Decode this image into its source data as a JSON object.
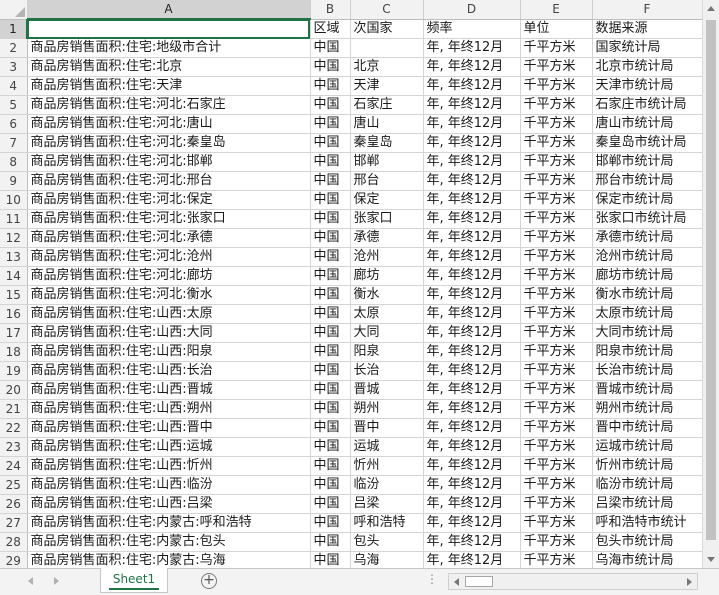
{
  "sheet": {
    "column_headers": [
      "A",
      "B",
      "C",
      "D",
      "E",
      "F"
    ],
    "rows": [
      {
        "n": "1",
        "a": "",
        "b": "区域",
        "c": "次国家",
        "d": "频率",
        "e": "单位",
        "f": "数据来源"
      },
      {
        "n": "2",
        "a": "商品房销售面积:住宅:地级市合计",
        "b": "中国",
        "c": "",
        "d": "年, 年终12月",
        "e": "千平方米",
        "f": "国家统计局"
      },
      {
        "n": "3",
        "a": "商品房销售面积:住宅:北京",
        "b": "中国",
        "c": "北京",
        "d": "年, 年终12月",
        "e": "千平方米",
        "f": "北京市统计局"
      },
      {
        "n": "4",
        "a": "商品房销售面积:住宅:天津",
        "b": "中国",
        "c": "天津",
        "d": "年, 年终12月",
        "e": "千平方米",
        "f": "天津市统计局"
      },
      {
        "n": "5",
        "a": "商品房销售面积:住宅:河北:石家庄",
        "b": "中国",
        "c": "石家庄",
        "d": "年, 年终12月",
        "e": "千平方米",
        "f": "石家庄市统计局"
      },
      {
        "n": "6",
        "a": "商品房销售面积:住宅:河北:唐山",
        "b": "中国",
        "c": "唐山",
        "d": "年, 年终12月",
        "e": "千平方米",
        "f": "唐山市统计局"
      },
      {
        "n": "7",
        "a": "商品房销售面积:住宅:河北:秦皇岛",
        "b": "中国",
        "c": "秦皇岛",
        "d": "年, 年终12月",
        "e": "千平方米",
        "f": "秦皇岛市统计局"
      },
      {
        "n": "8",
        "a": "商品房销售面积:住宅:河北:邯郸",
        "b": "中国",
        "c": "邯郸",
        "d": "年, 年终12月",
        "e": "千平方米",
        "f": "邯郸市统计局"
      },
      {
        "n": "9",
        "a": "商品房销售面积:住宅:河北:邢台",
        "b": "中国",
        "c": "邢台",
        "d": "年, 年终12月",
        "e": "千平方米",
        "f": "邢台市统计局"
      },
      {
        "n": "10",
        "a": "商品房销售面积:住宅:河北:保定",
        "b": "中国",
        "c": "保定",
        "d": "年, 年终12月",
        "e": "千平方米",
        "f": "保定市统计局"
      },
      {
        "n": "11",
        "a": "商品房销售面积:住宅:河北:张家口",
        "b": "中国",
        "c": "张家口",
        "d": "年, 年终12月",
        "e": "千平方米",
        "f": "张家口市统计局"
      },
      {
        "n": "12",
        "a": "商品房销售面积:住宅:河北:承德",
        "b": "中国",
        "c": "承德",
        "d": "年, 年终12月",
        "e": "千平方米",
        "f": "承德市统计局"
      },
      {
        "n": "13",
        "a": "商品房销售面积:住宅:河北:沧州",
        "b": "中国",
        "c": "沧州",
        "d": "年, 年终12月",
        "e": "千平方米",
        "f": "沧州市统计局"
      },
      {
        "n": "14",
        "a": "商品房销售面积:住宅:河北:廊坊",
        "b": "中国",
        "c": "廊坊",
        "d": "年, 年终12月",
        "e": "千平方米",
        "f": "廊坊市统计局"
      },
      {
        "n": "15",
        "a": "商品房销售面积:住宅:河北:衡水",
        "b": "中国",
        "c": "衡水",
        "d": "年, 年终12月",
        "e": "千平方米",
        "f": "衡水市统计局"
      },
      {
        "n": "16",
        "a": "商品房销售面积:住宅:山西:太原",
        "b": "中国",
        "c": "太原",
        "d": "年, 年终12月",
        "e": "千平方米",
        "f": "太原市统计局"
      },
      {
        "n": "17",
        "a": "商品房销售面积:住宅:山西:大同",
        "b": "中国",
        "c": "大同",
        "d": "年, 年终12月",
        "e": "千平方米",
        "f": "大同市统计局"
      },
      {
        "n": "18",
        "a": "商品房销售面积:住宅:山西:阳泉",
        "b": "中国",
        "c": "阳泉",
        "d": "年, 年终12月",
        "e": "千平方米",
        "f": "阳泉市统计局"
      },
      {
        "n": "19",
        "a": "商品房销售面积:住宅:山西:长治",
        "b": "中国",
        "c": "长治",
        "d": "年, 年终12月",
        "e": "千平方米",
        "f": "长治市统计局"
      },
      {
        "n": "20",
        "a": "商品房销售面积:住宅:山西:晋城",
        "b": "中国",
        "c": "晋城",
        "d": "年, 年终12月",
        "e": "千平方米",
        "f": "晋城市统计局"
      },
      {
        "n": "21",
        "a": "商品房销售面积:住宅:山西:朔州",
        "b": "中国",
        "c": "朔州",
        "d": "年, 年终12月",
        "e": "千平方米",
        "f": "朔州市统计局"
      },
      {
        "n": "22",
        "a": "商品房销售面积:住宅:山西:晋中",
        "b": "中国",
        "c": "晋中",
        "d": "年, 年终12月",
        "e": "千平方米",
        "f": "晋中市统计局"
      },
      {
        "n": "23",
        "a": "商品房销售面积:住宅:山西:运城",
        "b": "中国",
        "c": "运城",
        "d": "年, 年终12月",
        "e": "千平方米",
        "f": "运城市统计局"
      },
      {
        "n": "24",
        "a": "商品房销售面积:住宅:山西:忻州",
        "b": "中国",
        "c": "忻州",
        "d": "年, 年终12月",
        "e": "千平方米",
        "f": "忻州市统计局"
      },
      {
        "n": "25",
        "a": "商品房销售面积:住宅:山西:临汾",
        "b": "中国",
        "c": "临汾",
        "d": "年, 年终12月",
        "e": "千平方米",
        "f": "临汾市统计局"
      },
      {
        "n": "26",
        "a": "商品房销售面积:住宅:山西:吕梁",
        "b": "中国",
        "c": "吕梁",
        "d": "年, 年终12月",
        "e": "千平方米",
        "f": "吕梁市统计局"
      },
      {
        "n": "27",
        "a": "商品房销售面积:住宅:内蒙古:呼和浩特",
        "b": "中国",
        "c": "呼和浩特",
        "d": "年, 年终12月",
        "e": "千平方米",
        "f": "呼和浩特市统计"
      },
      {
        "n": "28",
        "a": "商品房销售面积:住宅:内蒙古:包头",
        "b": "中国",
        "c": "包头",
        "d": "年, 年终12月",
        "e": "千平方米",
        "f": "包头市统计局"
      },
      {
        "n": "29",
        "a": "商品房销售面积:住宅:内蒙古:乌海",
        "b": "中国",
        "c": "乌海",
        "d": "年, 年终12月",
        "e": "千平方米",
        "f": "乌海市统计局"
      }
    ]
  },
  "tabs": {
    "active_sheet": "Sheet1",
    "add_sheet_label": "+",
    "more_label": "⋮"
  },
  "colors": {
    "accent": "#217346",
    "header_bg": "#f2f2f2",
    "gridline": "#d4d4d4"
  }
}
